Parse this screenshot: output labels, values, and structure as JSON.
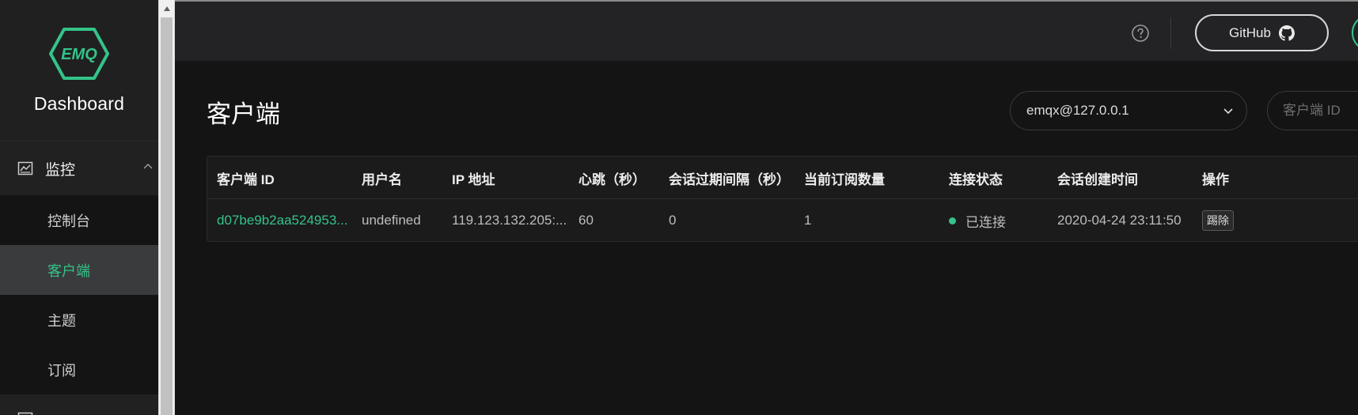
{
  "sidebar": {
    "brand": {
      "logo_text": "EMQ",
      "title": "Dashboard"
    },
    "group": {
      "label": "监控",
      "icon": "monitor-chart-icon"
    },
    "items": [
      {
        "label": "控制台"
      },
      {
        "label": "客户端",
        "active": true
      },
      {
        "label": "主题"
      },
      {
        "label": "订阅"
      }
    ]
  },
  "header": {
    "help_icon": "help-circle-icon",
    "github": {
      "label": "GitHub",
      "icon": "github-icon"
    }
  },
  "main": {
    "title": "客户端",
    "node_select": {
      "value": "emqx@127.0.0.1"
    },
    "search": {
      "placeholder": "客户端 ID"
    },
    "table": {
      "columns": [
        "客户端 ID",
        "用户名",
        "IP 地址",
        "心跳（秒）",
        "会话过期间隔（秒）",
        "当前订阅数量",
        "连接状态",
        "会话创建时间",
        "操作"
      ],
      "rows": [
        {
          "client_id": "d07be9b2aa524953...",
          "username": "undefined",
          "ip": "119.123.132.205:...",
          "keepalive": "60",
          "expiry": "0",
          "subscriptions": "1",
          "status": "已连接",
          "created_at": "2020-04-24 23:11:50",
          "action": "踢除"
        }
      ]
    }
  },
  "colors": {
    "accent": "#34c388",
    "sidebar_bg": "#1e1e1f",
    "header_bg": "#232325",
    "main_bg": "#141414",
    "active_item_bg": "#3a3b3d"
  }
}
